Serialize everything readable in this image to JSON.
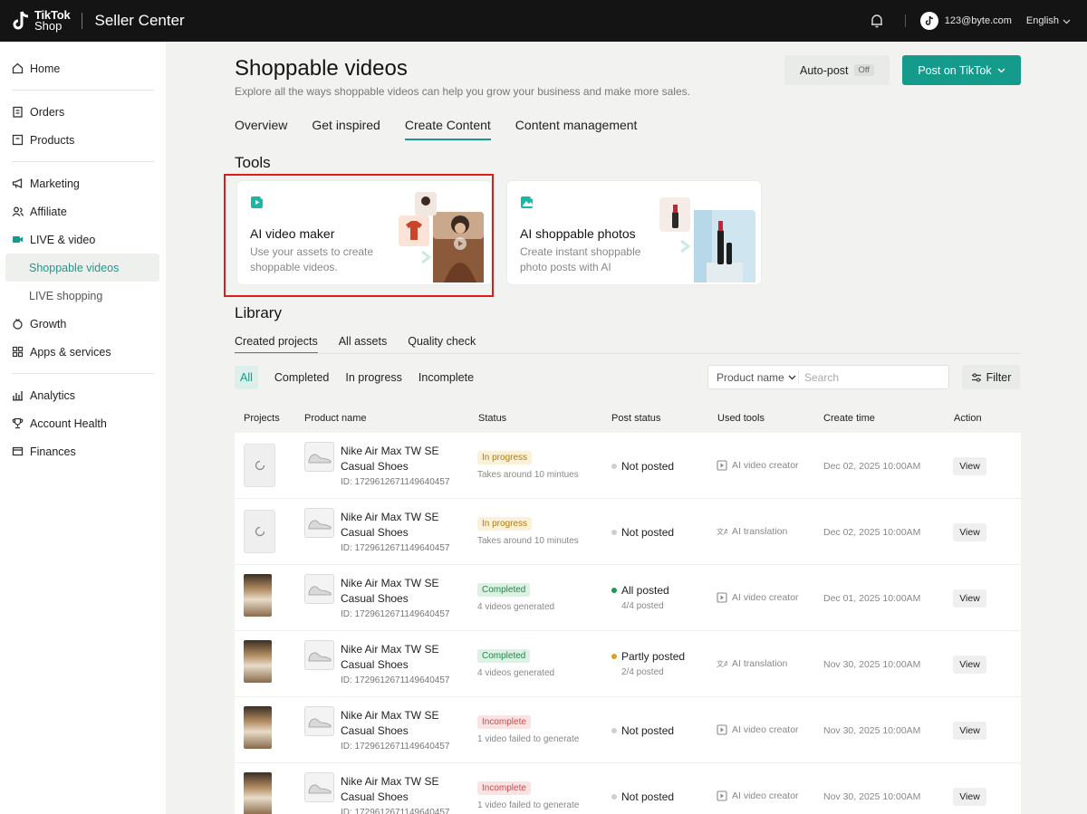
{
  "topbar": {
    "logo_line1": "TikTok",
    "logo_line2": "Shop",
    "app_title": "Seller Center",
    "user_email": "123@byte.com",
    "language": "English"
  },
  "sidebar": {
    "items": [
      {
        "label": "Home",
        "icon": "home-icon"
      },
      {
        "label": "Orders",
        "icon": "clipboard-icon"
      },
      {
        "label": "Products",
        "icon": "box-icon"
      },
      {
        "label": "Marketing",
        "icon": "megaphone-icon"
      },
      {
        "label": "Affiliate",
        "icon": "users-icon"
      },
      {
        "label": "LIVE & video",
        "icon": "video-icon"
      },
      {
        "label": "Shoppable videos"
      },
      {
        "label": "LIVE shopping"
      },
      {
        "label": "Growth",
        "icon": "growth-icon"
      },
      {
        "label": "Apps & services",
        "icon": "grid-icon"
      },
      {
        "label": "Analytics",
        "icon": "chart-icon"
      },
      {
        "label": "Account Health",
        "icon": "trophy-icon"
      },
      {
        "label": "Finances",
        "icon": "wallet-icon"
      }
    ]
  },
  "header": {
    "title": "Shoppable videos",
    "subtitle": "Explore all the ways shoppable videos can help you grow your business and make more sales.",
    "autopost_label": "Auto-post",
    "autopost_state": "Off",
    "post_button": "Post on TikTok"
  },
  "tabs": [
    "Overview",
    "Get inspired",
    "Create Content",
    "Content management"
  ],
  "tools": {
    "heading": "Tools",
    "cards": [
      {
        "title": "AI video maker",
        "description": "Use your assets to create shoppable videos."
      },
      {
        "title": "AI shoppable photos",
        "description": "Create instant shoppable photo posts with AI"
      }
    ]
  },
  "library": {
    "heading": "Library",
    "tabs": [
      "Created projects",
      "All assets",
      "Quality check"
    ],
    "filters": [
      "All",
      "Completed",
      "In progress",
      "Incomplete"
    ],
    "search_field": "Product name",
    "search_placeholder": "Search",
    "filter_button": "Filter",
    "columns": [
      "Projects",
      "Product name",
      "Status",
      "Post status",
      "Used tools",
      "Create time",
      "Action"
    ],
    "rows": [
      {
        "name": "Nike Air Max TW SE Casual Shoes",
        "id": "ID: 1729612671149640457",
        "status": "In progress",
        "status_sub": "Takes around 10 mintues",
        "post": "Not posted",
        "post_sub": "",
        "tool": "AI video creator",
        "time": "Dec 02, 2025 10:00AM",
        "action": "View"
      },
      {
        "name": "Nike Air Max TW SE Casual Shoes",
        "id": "ID: 1729612671149640457",
        "status": "In progress",
        "status_sub": "Takes around 10 minutes",
        "post": "Not posted",
        "post_sub": "",
        "tool": "AI translation",
        "time": "Dec 02, 2025 10:00AM",
        "action": "View"
      },
      {
        "name": "Nike Air Max TW SE Casual Shoes",
        "id": "ID: 1729612671149640457",
        "status": "Completed",
        "status_sub": "4 videos generated",
        "post": "All posted",
        "post_sub": "4/4 posted",
        "tool": "AI video creator",
        "time": "Dec 01, 2025 10:00AM",
        "action": "View"
      },
      {
        "name": "Nike Air Max TW SE Casual Shoes",
        "id": "ID: 1729612671149640457",
        "status": "Completed",
        "status_sub": "4 videos generated",
        "post": "Partly posted",
        "post_sub": "2/4 posted",
        "tool": "AI translation",
        "time": "Nov 30, 2025 10:00AM",
        "action": "View"
      },
      {
        "name": "Nike Air Max TW SE Casual Shoes",
        "id": "ID: 1729612671149640457",
        "status": "Incomplete",
        "status_sub": "1 video failed to generate",
        "post": "Not posted",
        "post_sub": "",
        "tool": "AI video creator",
        "time": "Nov 30, 2025 10:00AM",
        "action": "View"
      },
      {
        "name": "Nike Air Max TW SE Casual Shoes",
        "id": "ID: 1729612671149640457",
        "status": "Incomplete",
        "status_sub": "1 video failed to generate",
        "post": "Not posted",
        "post_sub": "",
        "tool": "AI video creator",
        "time": "Nov 30, 2025 10:00AM",
        "action": "View"
      }
    ]
  },
  "colors": {
    "accent": "#149b8c",
    "highlight": "#e01b1b",
    "topbar": "#141414"
  }
}
